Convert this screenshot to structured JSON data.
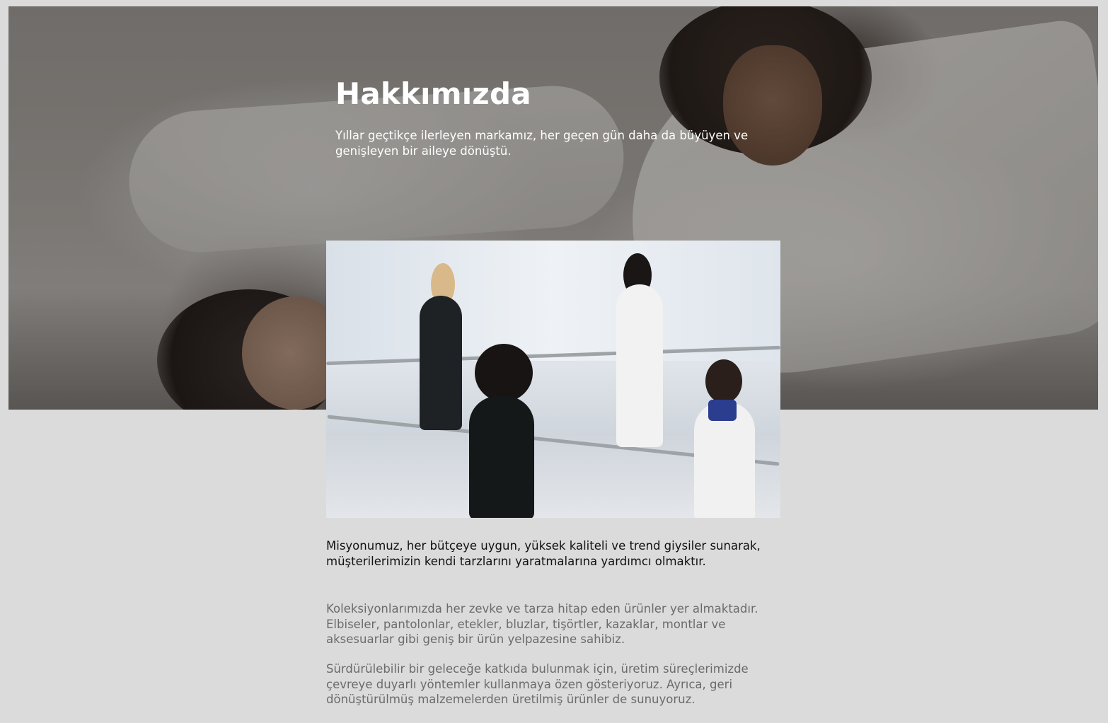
{
  "hero": {
    "title": "Hakkımızda",
    "subtitle": "Yıllar geçtikçe ilerleyen markamız, her geçen gün daha da büyüyen ve genişleyen bir aileye dönüştü."
  },
  "content": {
    "mission": "Misyonumuz, her bütçeye uygun, yüksek kaliteli ve trend giysiler sunarak, müşterilerimizin kendi tarzlarını yaratmalarına yardımcı olmaktır.",
    "paragraphs": [
      "Koleksiyonlarımızda her zevke ve tarza hitap eden ürünler yer almaktadır. Elbiseler, pantolonlar, etekler, bluzlar, tişörtler, kazaklar, montlar ve aksesuarlar gibi geniş bir ürün yelpazesine sahibiz.",
      "Sürdürülebilir bir geleceğe katkıda bulunmak için, üretim süreçlerimizde çevreye duyarlı yöntemler kullanmaya özen gösteriyoruz. Ayrıca, geri dönüştürülmüş malzemelerden üretilmiş ürünler de sunuyoruz."
    ]
  },
  "colors": {
    "page_background": "#dbdbdb",
    "hero_text": "#ffffff",
    "mission_text": "#111111",
    "body_text": "#6b6b6b"
  }
}
